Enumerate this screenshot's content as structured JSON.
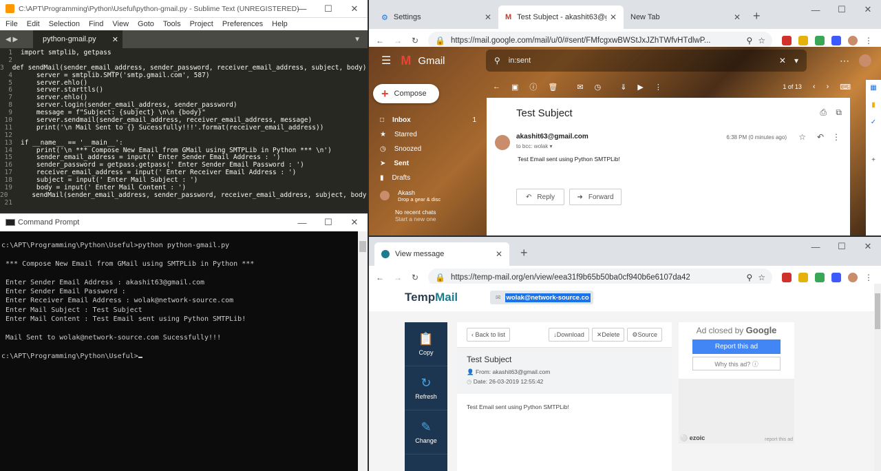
{
  "sublime": {
    "title": "C:\\APT\\Programming\\Python\\Useful\\python-gmail.py - Sublime Text (UNREGISTERED)",
    "menu": [
      "File",
      "Edit",
      "Selection",
      "Find",
      "View",
      "Goto",
      "Tools",
      "Project",
      "Preferences",
      "Help"
    ],
    "tab": "python-gmail.py",
    "lines": [
      "import smtplib, getpass",
      "",
      "def sendMail(sender_email_address, sender_password, receiver_email_address, subject, body):",
      "    server = smtplib.SMTP('smtp.gmail.com', 587)",
      "    server.ehlo()",
      "    server.starttls()",
      "    server.ehlo()",
      "    server.login(sender_email_address, sender_password)",
      "    message = f\"Subject: {subject} \\n\\n {body}\"",
      "    server.sendmail(sender_email_address, receiver_email_address, message)",
      "    print('\\n Mail Sent to {} Sucessfully!!!'.format(receiver_email_address))",
      "",
      "if __name__ == '__main__':",
      "    print('\\n *** Compose New Email from GMail using SMTPLib in Python *** \\n')",
      "    sender_email_address = input(' Enter Sender Email Address : ')",
      "    sender_password = getpass.getpass(' Enter Sender Email Password : ')",
      "    receiver_email_address = input(' Enter Receiver Email Address : ')",
      "    subject = input(' Enter Mail Subject : ')",
      "    body = input(' Enter Mail Content : ')",
      "    sendMail(sender_email_address, sender_password, receiver_email_address, subject, body)",
      ""
    ],
    "line_numbers": [
      "1",
      "2",
      "3",
      "4",
      "5",
      "6",
      "7",
      "8",
      "9",
      "10",
      "11",
      "12",
      "13",
      "14",
      "15",
      "16",
      "17",
      "18",
      "19",
      "20",
      "21"
    ]
  },
  "cmd": {
    "title": "Command Prompt",
    "output": "c:\\APT\\Programming\\Python\\Useful>python python-gmail.py\n\n *** Compose New Email from GMail using SMTPLib in Python ***\n\n Enter Sender Email Address : akashit63@gmail.com\n Enter Sender Email Password :\n Enter Receiver Email Address : wolak@network-source.com\n Enter Mail Subject : Test Subject\n Enter Mail Content : Test Email sent using Python SMTPLib!\n\n Mail Sent to wolak@network-source.com Sucessfully!!!\n\nc:\\APT\\Programming\\Python\\Useful>"
  },
  "chrome1": {
    "tabs": [
      "Settings",
      "Test Subject - akashit63@gm",
      "New Tab"
    ],
    "url": "https://mail.google.com/mail/u/0/#sent/FMfcgxwBWStJxJZhTWfvHTdlwP...",
    "gmail": {
      "logo": "Gmail",
      "search": "in:sent",
      "compose": "Compose",
      "nav": [
        {
          "label": "Inbox",
          "count": "1"
        },
        {
          "label": "Starred",
          "count": ""
        },
        {
          "label": "Snoozed",
          "count": ""
        },
        {
          "label": "Sent",
          "count": ""
        },
        {
          "label": "Drafts",
          "count": ""
        }
      ],
      "user": "Akash",
      "user_sub": "Drop a gear & disc",
      "no_chats": "No recent chats",
      "start_chat": "Start a new one",
      "pager": "1 of 13",
      "subject": "Test Subject",
      "from": "akashit63@gmail.com",
      "to": "to bcc: wolak",
      "time": "6:38 PM (0 minutes ago)",
      "body": "Test Email sent using Python SMTPLib!",
      "reply": "Reply",
      "forward": "Forward"
    }
  },
  "chrome2": {
    "tab": "View message",
    "url": "https://temp-mail.org/en/view/eea31f9b65b50ba0cf940b6e6107da42",
    "tempmail": {
      "logo_a": "Temp",
      "logo_b": "Mail",
      "email": "wolak@network-source.co",
      "side": [
        "Copy",
        "Refresh",
        "Change"
      ],
      "back": "Back to list",
      "download": "Download",
      "delete": "Delete",
      "source": "Source",
      "subject": "Test Subject",
      "from": "From: akashit63@gmail.com",
      "date": "Date: 26-03-2019 12:55:42",
      "body": "Test Email sent using Python SMTPLib!",
      "ad_closed": "Ad closed by",
      "google": "Google",
      "report": "Report this ad",
      "why": "Why this ad? ⓘ",
      "ezoic": "ezoic",
      "report_small": "report this ad"
    }
  }
}
